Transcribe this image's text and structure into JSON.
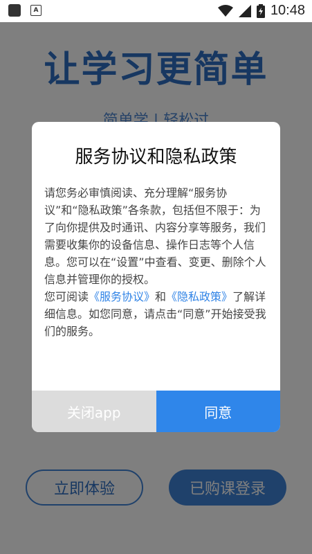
{
  "status_bar": {
    "time": "10:48",
    "icons": [
      "notification-square-icon",
      "app-a-icon",
      "wifi-icon",
      "signal-icon",
      "battery-charging-icon"
    ]
  },
  "screen": {
    "title": "让学习更简单",
    "subtitle": "简单学 | 轻松过",
    "try_button": "立即体验",
    "login_button": "已购课登录"
  },
  "dialog": {
    "title": "服务协议和隐私政策",
    "p1": "请您务必审慎阅读、充分理解“服务协议”和“隐私政策”各条款，包括但不限于：为了向你提供及时通讯、内容分享等服务，我们需要收集你的设备信息、操作日志等个人信息。您可以在“设置”中查看、变更、删除个人信息并管理你的授权。",
    "p2_prefix": "您可阅读",
    "link_service": "《服务协议》",
    "p2_and": "和",
    "link_privacy": "《隐私政策》",
    "p2_suffix": "了解详细信息。如您同意，请点击“同意”开始接受我们的服务。",
    "close_button": "关闭app",
    "agree_button": "同意"
  },
  "colors": {
    "accent": "#2f86ea",
    "brand_blue": "#2f6fc3",
    "overlay": "rgba(0,0,0,0.5)"
  }
}
